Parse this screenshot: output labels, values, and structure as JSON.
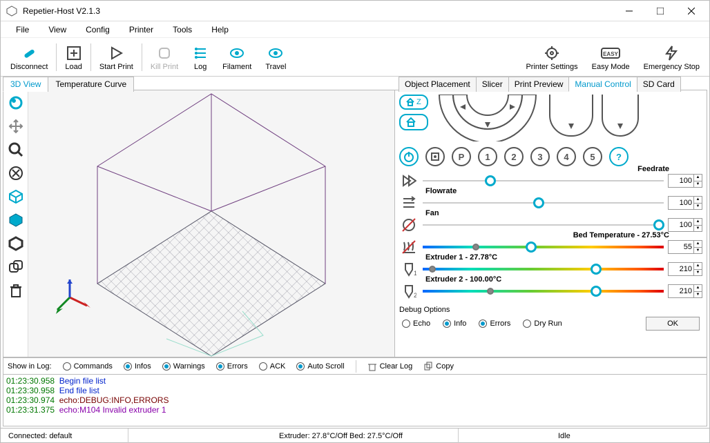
{
  "window": {
    "title": "Repetier-Host V2.1.3"
  },
  "menu": {
    "file": "File",
    "view": "View",
    "config": "Config",
    "printer": "Printer",
    "tools": "Tools",
    "help": "Help"
  },
  "toolbar": {
    "disconnect": "Disconnect",
    "load": "Load",
    "start": "Start Print",
    "kill": "Kill Print",
    "log": "Log",
    "filament": "Filament",
    "travel": "Travel",
    "psettings": "Printer Settings",
    "easy": "Easy Mode",
    "estop": "Emergency Stop"
  },
  "lefttabs": {
    "view3d": "3D View",
    "tempcurve": "Temperature Curve"
  },
  "righttabs": {
    "obj": "Object Placement",
    "slicer": "Slicer",
    "preview": "Print Preview",
    "manual": "Manual Control",
    "sd": "SD Card"
  },
  "home": {
    "z": "Z"
  },
  "circlerow": {
    "p": "P",
    "b1": "1",
    "b2": "2",
    "b3": "3",
    "b4": "4",
    "b5": "5",
    "q": "?"
  },
  "sliders": {
    "feedrate": {
      "label": "Feedrate",
      "value": "100"
    },
    "flowrate": {
      "label": "Flowrate",
      "value": "100"
    },
    "fan": {
      "label": "Fan",
      "value": "100"
    },
    "bed": {
      "label": "Bed Temperature - 27.53°C",
      "value": "55"
    },
    "ex1": {
      "label": "Extruder 1 - 27.78°C",
      "value": "210"
    },
    "ex2": {
      "label": "Extruder 2 - 100.00°C",
      "value": "210"
    }
  },
  "debug": {
    "header": "Debug Options",
    "echo": "Echo",
    "info": "Info",
    "errors": "Errors",
    "dry": "Dry Run",
    "ok": "OK"
  },
  "logtb": {
    "label": "Show in Log:",
    "commands": "Commands",
    "infos": "Infos",
    "warnings": "Warnings",
    "errors": "Errors",
    "ack": "ACK",
    "autoscroll": "Auto Scroll",
    "clear": "Clear Log",
    "copy": "Copy"
  },
  "log": [
    {
      "ts": "01:23:30.958",
      "cls": "msgI",
      "msg": "Begin file list"
    },
    {
      "ts": "01:23:30.958",
      "cls": "msgI",
      "msg": "End file list"
    },
    {
      "ts": "01:23:30.974",
      "cls": "msgD",
      "msg": "echo:DEBUG:INFO,ERRORS"
    },
    {
      "ts": "01:23:31.375",
      "cls": "msgE",
      "msg": "echo:M104 Invalid extruder 1"
    }
  ],
  "status": {
    "conn": "Connected: default",
    "temps": "Extruder: 27.8°C/Off Bed: 27.5°C/Off",
    "idle": "Idle"
  }
}
